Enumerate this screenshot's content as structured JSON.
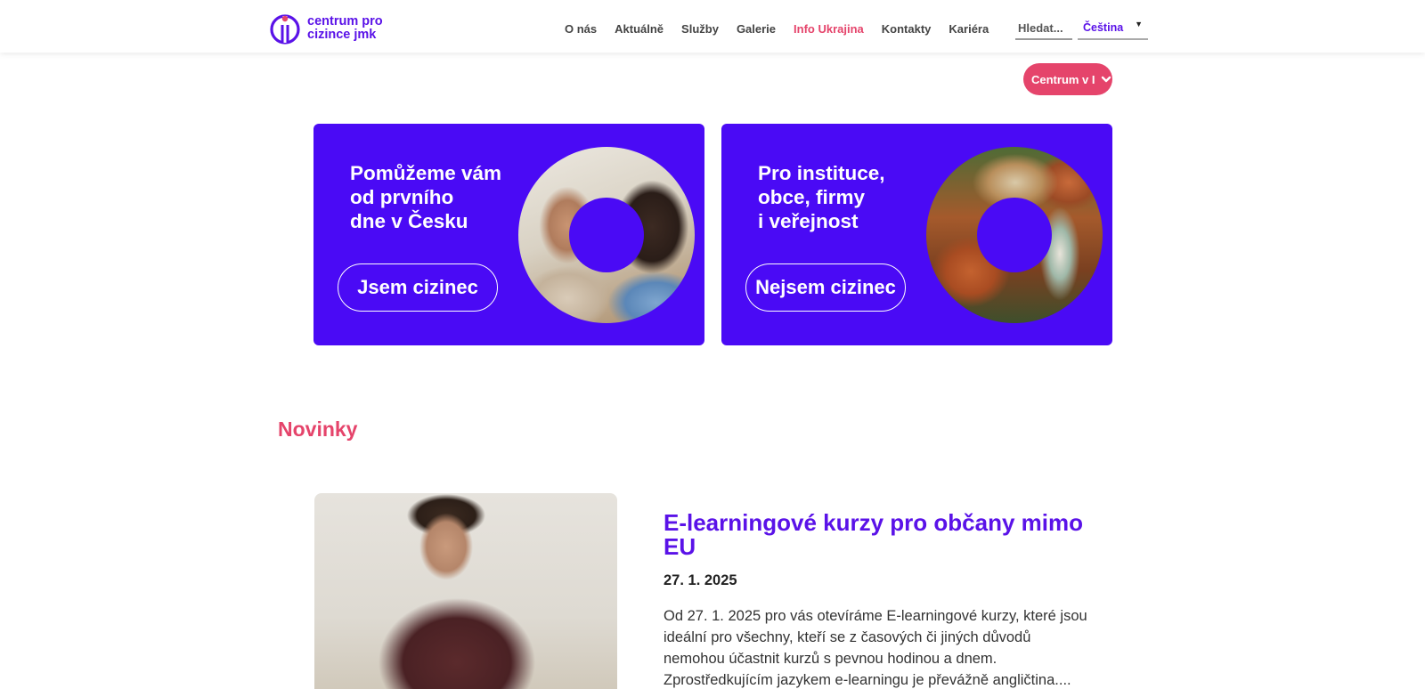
{
  "header": {
    "logo_line1": "centrum pro",
    "logo_line2": "cizince jmk",
    "nav": [
      {
        "label": "O nás"
      },
      {
        "label": "Aktuálně"
      },
      {
        "label": "Služby"
      },
      {
        "label": "Galerie"
      },
      {
        "label": "Info Ukrajina"
      },
      {
        "label": "Kontakty"
      },
      {
        "label": "Kariéra"
      }
    ],
    "search_placeholder": "Hledat...",
    "language": "Čeština"
  },
  "location_pill": "Centrum v I",
  "cards": [
    {
      "title_lines": [
        "Pomůžeme vám",
        "od prvního",
        "dne v Česku"
      ],
      "button": "Jsem cizinec"
    },
    {
      "title_lines": [
        "Pro instituce,",
        "obce, firmy",
        "i veřejnost"
      ],
      "button": "Nejsem cizinec"
    }
  ],
  "news": {
    "section_title": "Novinky",
    "items": [
      {
        "title": "E-learningové kurzy pro občany mimo EU",
        "date": "27. 1. 2025",
        "excerpt": "Od 27. 1. 2025 pro vás otevíráme E-learningové kurzy, které jsou ideální pro všechny, kteří se z časových či jiných důvodů nemohou účastnit kurzů s pevnou hodinou a dnem. Zprostředkujícím jazykem e-learningu je převážně angličtina...."
      }
    ]
  },
  "colors": {
    "brand_purple": "#4a0af5",
    "accent_pink": "#e5446b",
    "link_purple": "#5a12e8"
  },
  "icons": [
    "logo-mark-icon",
    "chevron-down-icon",
    "dropdown-arrow-icon"
  ]
}
